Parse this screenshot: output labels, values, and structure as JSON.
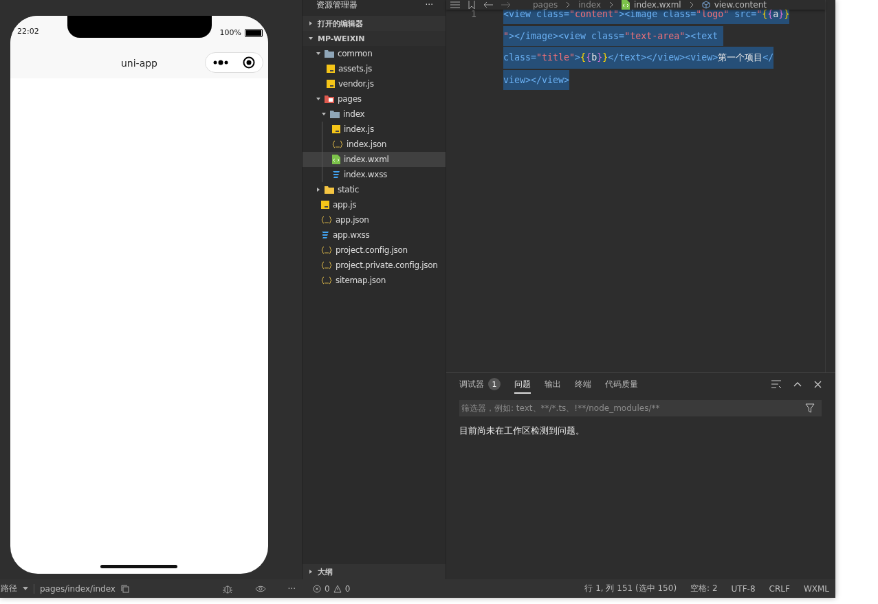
{
  "simulator": {
    "status_time": "22:02",
    "battery_text": "100%",
    "nav_title": "uni-app",
    "footer": {
      "path_label": "路径",
      "path": "pages/index/index",
      "more": "···"
    }
  },
  "explorer": {
    "title": "资源管理器",
    "more": "···",
    "sections": [
      {
        "label": "打开的编辑器",
        "expanded": false
      },
      {
        "label": "MP-WEIXIN",
        "expanded": true
      }
    ],
    "tree": [
      {
        "name": "common",
        "kind": "folder",
        "expanded": true,
        "selected": false,
        "children": [
          {
            "name": "assets.js",
            "kind": "js",
            "selected": false
          },
          {
            "name": "vendor.js",
            "kind": "js",
            "selected": false
          }
        ]
      },
      {
        "name": "pages",
        "kind": "pagesfolder",
        "expanded": true,
        "selected": false,
        "children": [
          {
            "name": "index",
            "kind": "folder",
            "expanded": true,
            "selected": false,
            "children": [
              {
                "name": "index.js",
                "kind": "js",
                "selected": false
              },
              {
                "name": "index.json",
                "kind": "json",
                "selected": false
              },
              {
                "name": "index.wxml",
                "kind": "wxml",
                "selected": true
              },
              {
                "name": "index.wxss",
                "kind": "wxss",
                "selected": false
              }
            ]
          }
        ]
      },
      {
        "name": "static",
        "kind": "staticfolder",
        "expanded": false,
        "selected": false
      },
      {
        "name": "app.js",
        "kind": "js",
        "selected": false
      },
      {
        "name": "app.json",
        "kind": "json",
        "selected": false
      },
      {
        "name": "app.wxss",
        "kind": "wxss",
        "selected": false
      },
      {
        "name": "project.config.json",
        "kind": "json",
        "selected": false
      },
      {
        "name": "project.private.config.json",
        "kind": "json",
        "selected": false
      },
      {
        "name": "sitemap.json",
        "kind": "json",
        "selected": false
      }
    ],
    "outline": {
      "label": "大纲",
      "expanded": false
    }
  },
  "editor": {
    "breadcrumb": [
      {
        "text": "pages",
        "kind": "plain"
      },
      {
        "text": "index",
        "kind": "plain"
      },
      {
        "text": "index.wxml",
        "kind": "wxml"
      },
      {
        "text": "view.content",
        "kind": "element"
      }
    ],
    "line_number": "1",
    "code_lines": [
      [
        {
          "text": "<view class=",
          "kind": "tag"
        },
        {
          "text": "\"content\"",
          "kind": "string"
        },
        {
          "text": "><image class=",
          "kind": "tag"
        },
        {
          "text": "\"logo\"",
          "kind": "string"
        },
        {
          "text": " src=",
          "kind": "tag"
        },
        {
          "text": "\"",
          "kind": "string"
        },
        {
          "text": "{",
          "kind": "brace"
        },
        {
          "text": "{",
          "kind": "brace2"
        },
        {
          "text": "a",
          "kind": "plain"
        },
        {
          "text": "}",
          "kind": "brace2"
        },
        {
          "text": "}",
          "kind": "brace"
        }
      ],
      [
        {
          "text": "\"",
          "kind": "string"
        },
        {
          "text": "></image><view class=",
          "kind": "tag"
        },
        {
          "text": "\"text-area\"",
          "kind": "string"
        },
        {
          "text": "><text ",
          "kind": "tag"
        }
      ],
      [
        {
          "text": "class=",
          "kind": "tag"
        },
        {
          "text": "\"title\"",
          "kind": "string"
        },
        {
          "text": ">",
          "kind": "tag"
        },
        {
          "text": "{",
          "kind": "brace"
        },
        {
          "text": "{",
          "kind": "brace2"
        },
        {
          "text": "b",
          "kind": "plain"
        },
        {
          "text": "}",
          "kind": "brace2"
        },
        {
          "text": "}",
          "kind": "brace"
        },
        {
          "text": "</text></view><view>",
          "kind": "tag"
        },
        {
          "text": "第一个项目",
          "kind": "plain"
        },
        {
          "text": "</",
          "kind": "tag"
        }
      ],
      [
        {
          "text": "view></view>",
          "kind": "tag"
        }
      ]
    ]
  },
  "panel": {
    "tabs": [
      {
        "label": "调试器",
        "badge": "1",
        "selected": false
      },
      {
        "label": "问题",
        "selected": true
      },
      {
        "label": "输出",
        "selected": false
      },
      {
        "label": "终端",
        "selected": false
      },
      {
        "label": "代码质量",
        "selected": false
      }
    ],
    "filter_placeholder": "筛选器，例如: text、**/*.ts、!**/node_modules/**",
    "message": "目前尚未在工作区检测到问题。"
  },
  "status_bar": {
    "errors": "0",
    "warnings": "0",
    "items": [
      "行 1, 列 151 (选中 150)",
      "空格: 2",
      "UTF-8",
      "CRLF",
      "WXML"
    ]
  }
}
